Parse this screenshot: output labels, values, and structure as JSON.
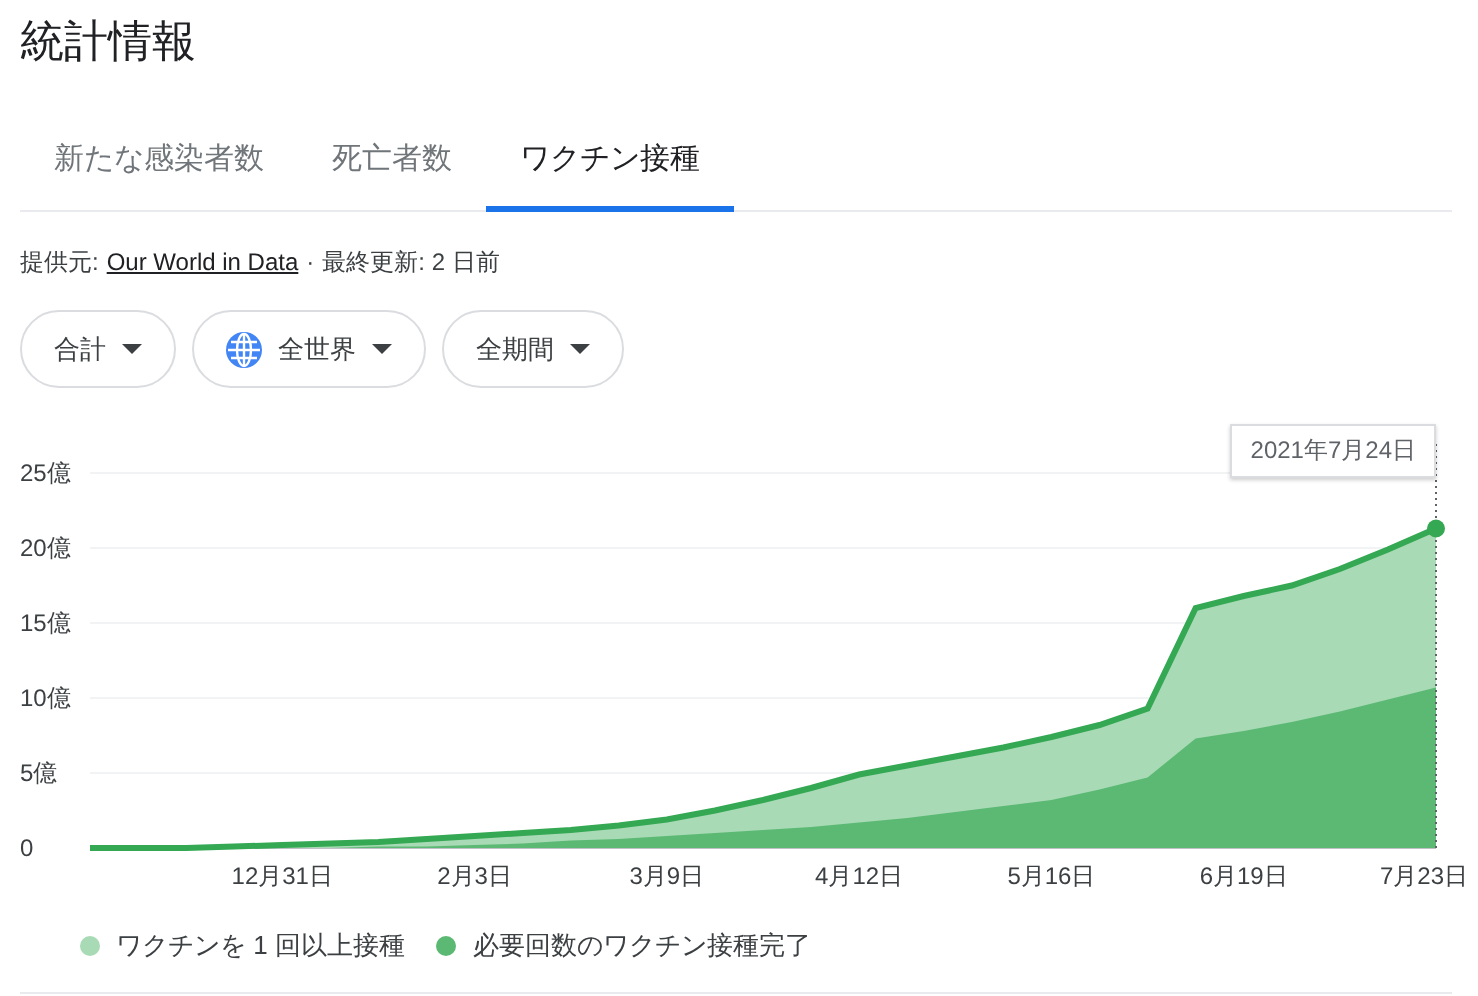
{
  "title": "統計情報",
  "tabs": [
    {
      "label": "新たな感染者数",
      "selected": false
    },
    {
      "label": "死亡者数",
      "selected": false
    },
    {
      "label": "ワクチン接種",
      "selected": true
    }
  ],
  "source": {
    "label": "提供元:",
    "link": "Our World in Data",
    "separator": "·",
    "updated": "最終更新: 2 日前"
  },
  "filters": [
    {
      "label": "合計",
      "kind": "plain"
    },
    {
      "label": "全世界",
      "kind": "globe"
    },
    {
      "label": "全期間",
      "kind": "plain"
    }
  ],
  "chart": {
    "tooltip": "2021年7月24日",
    "chart_data": {
      "type": "area",
      "stacked": false,
      "grid": true,
      "categories": [
        null,
        null,
        null,
        null,
        "12月31日",
        null,
        null,
        null,
        "2月3日",
        null,
        null,
        null,
        "3月9日",
        null,
        null,
        null,
        "4月12日",
        null,
        null,
        null,
        "5月16日",
        null,
        null,
        null,
        "6月19日",
        null,
        null,
        null,
        "7月23日"
      ],
      "series": [
        {
          "name": "ワクチンを 1 回以上接種",
          "color": "#a8dab5",
          "values": [
            0,
            0,
            0,
            0.1,
            0.2,
            0.3,
            0.4,
            0.6,
            0.8,
            1.0,
            1.2,
            1.5,
            1.9,
            2.5,
            3.2,
            4.0,
            4.9,
            5.5,
            6.1,
            6.7,
            7.4,
            8.2,
            9.3,
            16.0,
            16.8,
            17.5,
            18.6,
            19.9,
            21.3
          ]
        },
        {
          "name": "必要回数のワクチン接種完了",
          "color": "#5bb974",
          "values": [
            0,
            0,
            0,
            0,
            0,
            0,
            0.1,
            0.1,
            0.2,
            0.3,
            0.5,
            0.6,
            0.8,
            1.0,
            1.2,
            1.4,
            1.7,
            2.0,
            2.4,
            2.8,
            3.2,
            3.9,
            4.7,
            7.3,
            7.8,
            8.4,
            9.1,
            9.9,
            10.7
          ]
        }
      ],
      "ylim": [
        0,
        25
      ],
      "yticks": [
        {
          "value": 0,
          "label": "0"
        },
        {
          "value": 5,
          "label": "5億"
        },
        {
          "value": 10,
          "label": "10億"
        },
        {
          "value": 15,
          "label": "15億"
        },
        {
          "value": 20,
          "label": "20億"
        },
        {
          "value": 25,
          "label": "25億"
        }
      ]
    }
  }
}
